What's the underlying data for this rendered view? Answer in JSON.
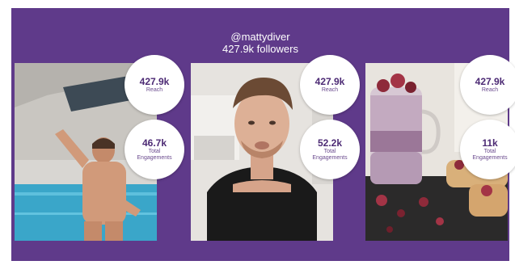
{
  "header": {
    "handle": "@mattydiver",
    "followers": "427.9k followers"
  },
  "posts": [
    {
      "reach_value": "427.9k",
      "reach_label": "Reach",
      "eng_value": "46.7k",
      "eng_label_1": "Total",
      "eng_label_2": "Engagements"
    },
    {
      "reach_value": "427.9k",
      "reach_label": "Reach",
      "eng_value": "52.2k",
      "eng_label_1": "Total",
      "eng_label_2": "Engagements"
    },
    {
      "reach_value": "427.9k",
      "reach_label": "Reach",
      "eng_value": "11k",
      "eng_label_1": "Total",
      "eng_label_2": "Engagements"
    }
  ],
  "colors": {
    "panel": "#5f3a8a",
    "badge_text": "#4c2a74",
    "badge_bg": "#ffffff"
  }
}
